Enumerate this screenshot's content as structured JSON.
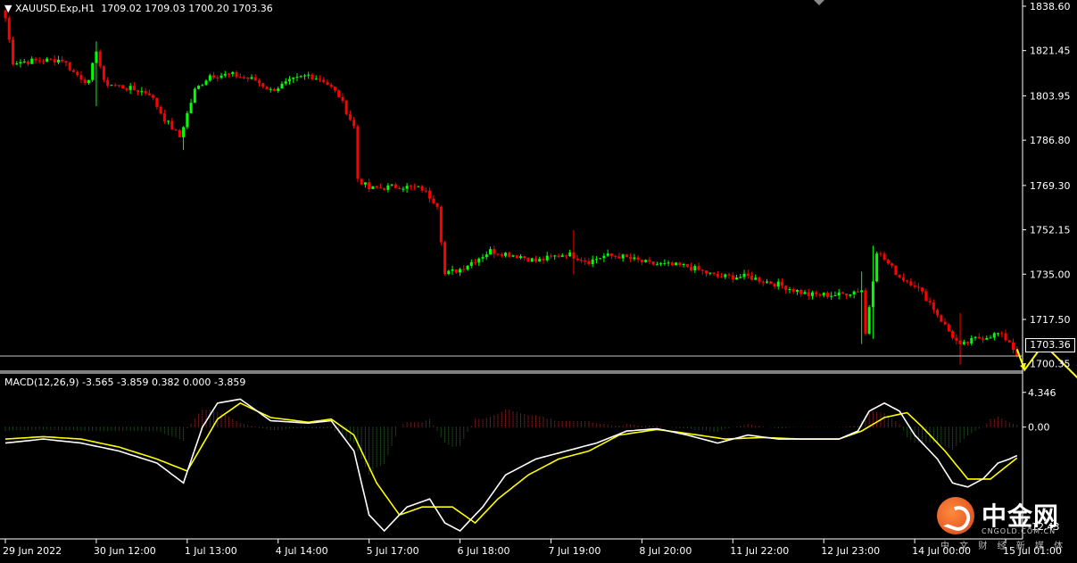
{
  "header": {
    "symbol": "XAUUSD.Exp,H1",
    "ohlc": "1709.02 1709.03 1700.20 1703.36"
  },
  "macd": {
    "header": "MACD(12,26,9) -3.565 -3.859 0.382 0.000 -3.859"
  },
  "current_price_label": "1703.36",
  "watermark": {
    "brand": "中金网",
    "site": "CNGOLD.COM.CN",
    "tagline": "中 文 财 经 新 媒 体"
  },
  "colors": {
    "background": "#000000",
    "bull": "#00ff00",
    "bear": "#ff0000",
    "macd_line": "#ffffff",
    "signal_line": "#ffff00",
    "hist_positive": "#c83232",
    "hist_negative": "#2e7d2e",
    "arrow": "#ffff00"
  },
  "chart_data": [
    {
      "type": "candlestick",
      "title": "XAUUSD.Exp,H1",
      "ylim": [
        1697.5,
        1841.0
      ],
      "y_ticks": [
        "1838.60",
        "1821.45",
        "1803.95",
        "1786.80",
        "1769.30",
        "1752.15",
        "1735.00",
        "1717.50",
        "1700.35"
      ],
      "x_ticks": [
        "29 Jun 2022",
        "30 Jun 12:00",
        "1 Jul 13:00",
        "4 Jul 14:00",
        "5 Jul 17:00",
        "6 Jul 18:00",
        "7 Jul 19:00",
        "8 Jul 20:00",
        "11 Jul 22:00",
        "12 Jul 23:00",
        "14 Jul 00:00",
        "15 Jul 01:00"
      ],
      "x_tick_index": [
        0,
        24,
        48,
        72,
        96,
        120,
        144,
        168,
        192,
        216,
        240,
        264
      ],
      "n_bars": 268,
      "close_anchors": [
        [
          0,
          1834
        ],
        [
          2,
          1817
        ],
        [
          15,
          1818
        ],
        [
          18,
          1813
        ],
        [
          22,
          1809
        ],
        [
          24,
          1822
        ],
        [
          26,
          1809
        ],
        [
          38,
          1805
        ],
        [
          42,
          1795
        ],
        [
          46,
          1788
        ],
        [
          50,
          1806
        ],
        [
          54,
          1812
        ],
        [
          60,
          1812
        ],
        [
          66,
          1810
        ],
        [
          70,
          1806
        ],
        [
          76,
          1810
        ],
        [
          80,
          1812
        ],
        [
          84,
          1810
        ],
        [
          88,
          1804
        ],
        [
          92,
          1792
        ],
        [
          93,
          1772
        ],
        [
          96,
          1768
        ],
        [
          104,
          1769
        ],
        [
          110,
          1768
        ],
        [
          114,
          1762
        ],
        [
          116,
          1735
        ],
        [
          120,
          1737
        ],
        [
          128,
          1744
        ],
        [
          136,
          1742
        ],
        [
          140,
          1740
        ],
        [
          148,
          1743
        ],
        [
          154,
          1740
        ],
        [
          158,
          1742
        ],
        [
          162,
          1742
        ],
        [
          170,
          1739
        ],
        [
          180,
          1738
        ],
        [
          188,
          1734
        ],
        [
          196,
          1734
        ],
        [
          204,
          1731
        ],
        [
          212,
          1727
        ],
        [
          220,
          1727
        ],
        [
          226,
          1729
        ],
        [
          227,
          1712
        ],
        [
          230,
          1744
        ],
        [
          236,
          1734
        ],
        [
          240,
          1731
        ],
        [
          244,
          1724
        ],
        [
          248,
          1715
        ],
        [
          252,
          1707
        ],
        [
          256,
          1710
        ],
        [
          262,
          1712
        ],
        [
          265,
          1709
        ],
        [
          267,
          1703.36
        ]
      ],
      "spikes": [
        [
          24,
          1825,
          1800
        ],
        [
          47,
          1790,
          1783
        ],
        [
          150,
          1752,
          1735
        ],
        [
          226,
          1736,
          1708
        ],
        [
          229,
          1746,
          1710
        ],
        [
          252,
          1720,
          1700
        ]
      ],
      "current_price": 1703.36,
      "forecast_path": [
        [
          267,
          1706
        ],
        [
          269,
          1698
        ],
        [
          274,
          1708
        ],
        [
          285,
          1692
        ]
      ]
    },
    {
      "type": "macd",
      "params": "12,26,9",
      "ylim": [
        -14.0,
        7.0
      ],
      "y_ticks": [
        "4.346",
        "0.00",
        "-12.43"
      ],
      "series": [
        {
          "name": "main",
          "anchors": [
            [
              0,
              -2
            ],
            [
              10,
              -1.5
            ],
            [
              20,
              -2
            ],
            [
              30,
              -3
            ],
            [
              40,
              -4.5
            ],
            [
              47,
              -7
            ],
            [
              52,
              0
            ],
            [
              56,
              3
            ],
            [
              62,
              3.5
            ],
            [
              70,
              0.8
            ],
            [
              80,
              0.5
            ],
            [
              86,
              0.8
            ],
            [
              92,
              -3
            ],
            [
              96,
              -11
            ],
            [
              100,
              -13
            ],
            [
              106,
              -10
            ],
            [
              112,
              -9
            ],
            [
              116,
              -12
            ],
            [
              120,
              -13
            ],
            [
              126,
              -10
            ],
            [
              132,
              -6
            ],
            [
              140,
              -4
            ],
            [
              148,
              -3
            ],
            [
              156,
              -2
            ],
            [
              164,
              -0.5
            ],
            [
              172,
              -0.2
            ],
            [
              180,
              -1
            ],
            [
              188,
              -2
            ],
            [
              196,
              -1
            ],
            [
              204,
              -1.5
            ],
            [
              212,
              -1.5
            ],
            [
              220,
              -1.5
            ],
            [
              225,
              -0.5
            ],
            [
              228,
              2
            ],
            [
              232,
              3
            ],
            [
              236,
              2
            ],
            [
              240,
              -1
            ],
            [
              246,
              -4
            ],
            [
              250,
              -7
            ],
            [
              254,
              -7.5
            ],
            [
              258,
              -6.5
            ],
            [
              262,
              -4.5
            ],
            [
              265,
              -4
            ],
            [
              267,
              -3.565
            ]
          ]
        },
        {
          "name": "signal",
          "anchors": [
            [
              0,
              -1.5
            ],
            [
              10,
              -1.2
            ],
            [
              20,
              -1.5
            ],
            [
              30,
              -2.5
            ],
            [
              40,
              -4
            ],
            [
              48,
              -5.5
            ],
            [
              56,
              1
            ],
            [
              62,
              3
            ],
            [
              70,
              1.2
            ],
            [
              80,
              0.6
            ],
            [
              86,
              1
            ],
            [
              92,
              -1
            ],
            [
              98,
              -7
            ],
            [
              104,
              -11
            ],
            [
              110,
              -10
            ],
            [
              118,
              -10
            ],
            [
              124,
              -12
            ],
            [
              130,
              -9
            ],
            [
              138,
              -6
            ],
            [
              146,
              -4
            ],
            [
              154,
              -3
            ],
            [
              162,
              -1
            ],
            [
              172,
              -0.3
            ],
            [
              180,
              -0.8
            ],
            [
              190,
              -1.5
            ],
            [
              200,
              -1.3
            ],
            [
              210,
              -1.5
            ],
            [
              220,
              -1.5
            ],
            [
              226,
              -0.5
            ],
            [
              232,
              1.2
            ],
            [
              238,
              1.8
            ],
            [
              242,
              0
            ],
            [
              248,
              -3
            ],
            [
              254,
              -6.5
            ],
            [
              260,
              -6.5
            ],
            [
              264,
              -5
            ],
            [
              267,
              -3.859
            ]
          ]
        }
      ]
    }
  ]
}
